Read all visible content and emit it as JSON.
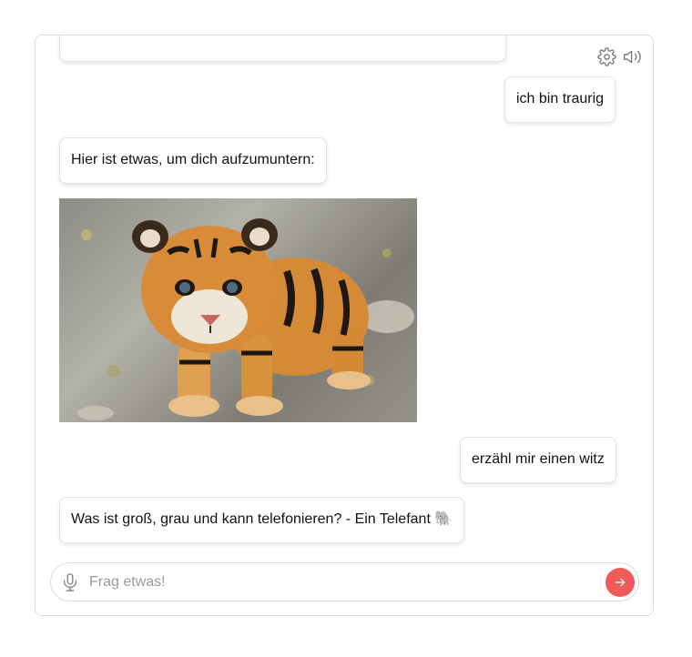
{
  "toolbar": {
    "settings_icon": "gear-icon",
    "sound_icon": "speaker-icon"
  },
  "messages": [
    {
      "role": "user",
      "text": "ich bin traurig"
    },
    {
      "role": "bot",
      "text": "Hier ist etwas, um dich aufzumuntern:"
    },
    {
      "role": "user",
      "text": "erzähl mir einen witz"
    },
    {
      "role": "bot",
      "text": "Was ist groß, grau und kann telefonieren? - Ein Telefant 🐘"
    }
  ],
  "input": {
    "placeholder": "Frag etwas!",
    "value": "",
    "mic_icon": "microphone-icon",
    "send_icon": "arrow-right-icon"
  },
  "colors": {
    "accent": "#ef5a5a",
    "border": "#dcdcdc",
    "placeholder": "#9a9a9a"
  }
}
